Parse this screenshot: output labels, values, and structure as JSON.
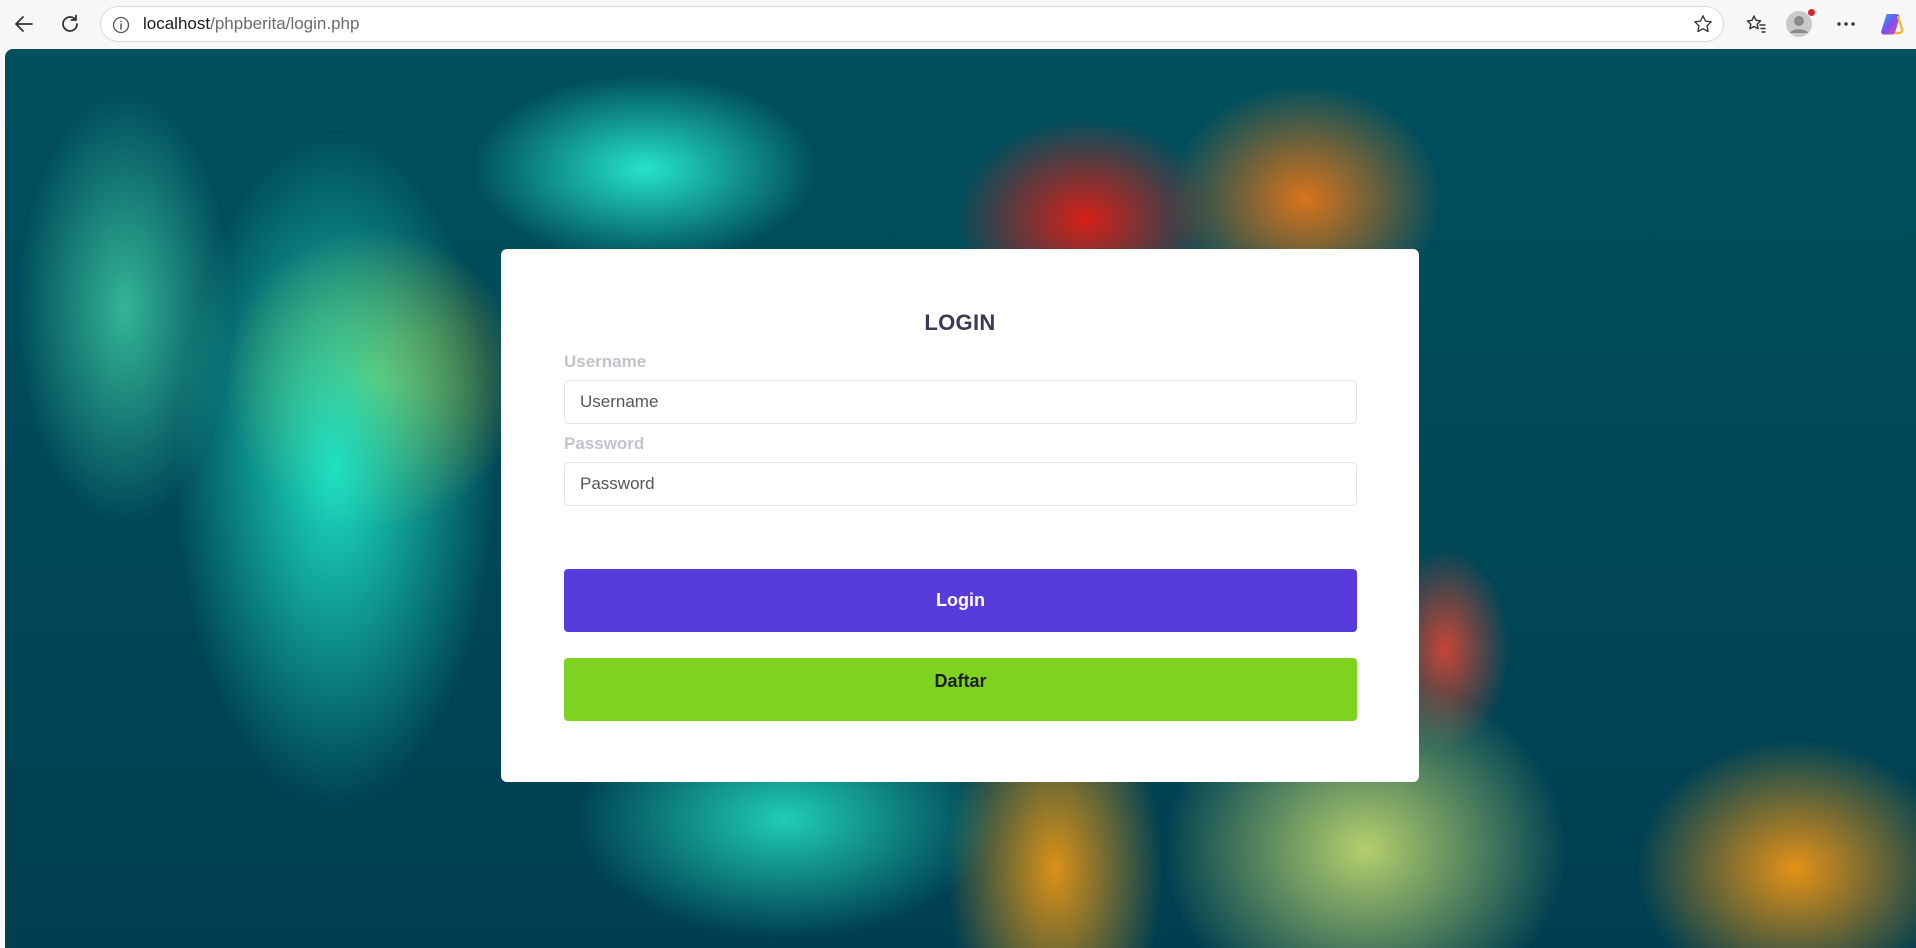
{
  "browser": {
    "url_host": "localhost",
    "url_path": "/phpberita/login.php",
    "icons": [
      "back-icon",
      "refresh-icon",
      "site-info-icon",
      "favorite-star-icon",
      "favorites-icon",
      "profile-avatar-icon",
      "more-icon",
      "copilot-icon"
    ]
  },
  "login": {
    "title": "LOGIN",
    "username_label": "Username",
    "username_placeholder": "Username",
    "password_label": "Password",
    "password_placeholder": "Password",
    "login_button": "Login",
    "register_button": "Daftar"
  },
  "colors": {
    "login_button": "#573bdb",
    "register_button": "#7ed321",
    "background": "#004858"
  }
}
